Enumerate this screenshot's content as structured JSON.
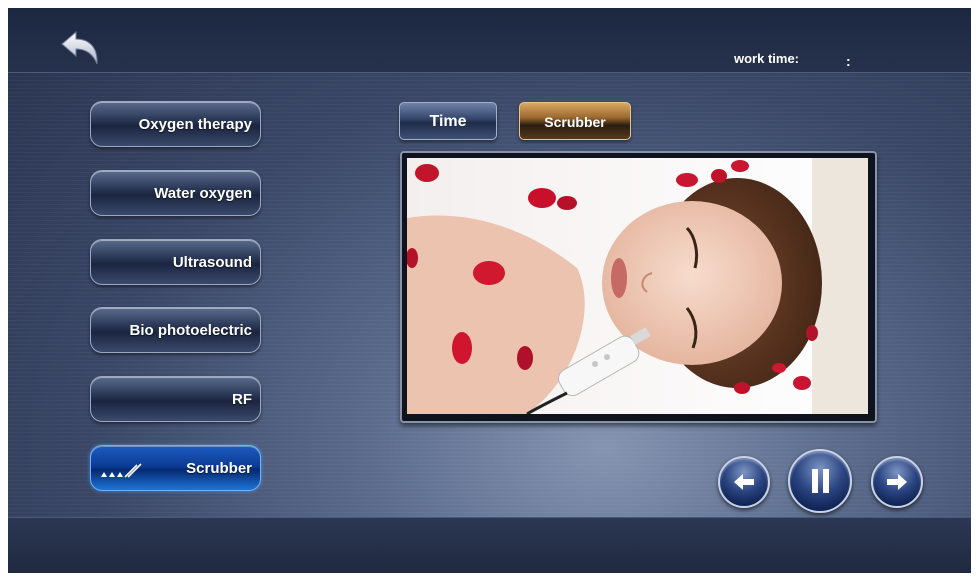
{
  "header": {
    "back_icon": "back-arrow-icon",
    "worktime_label": "work time:",
    "worktime_value": ":"
  },
  "menu": {
    "items": [
      {
        "label": "Oxygen therapy",
        "active": false
      },
      {
        "label": "Water oxygen",
        "active": false
      },
      {
        "label": "Ultrasound",
        "active": false
      },
      {
        "label": "Bio photoelectric",
        "active": false
      },
      {
        "label": "RF",
        "active": false
      },
      {
        "label": "Scrubber",
        "active": true,
        "icon": "scrubber-waveform-icon"
      }
    ]
  },
  "tabs": [
    {
      "label": "Time",
      "active": false
    },
    {
      "label": "Scrubber",
      "active": true
    }
  ],
  "video": {
    "content": "scrubber-treatment-photo"
  },
  "controls": {
    "prev_icon": "left-arrow-icon",
    "pause_icon": "pause-icon",
    "next_icon": "right-arrow-icon"
  },
  "colors": {
    "accent_active": "#0c3d96",
    "tab_active": "#9c6a2e",
    "background": "#3a4767"
  }
}
